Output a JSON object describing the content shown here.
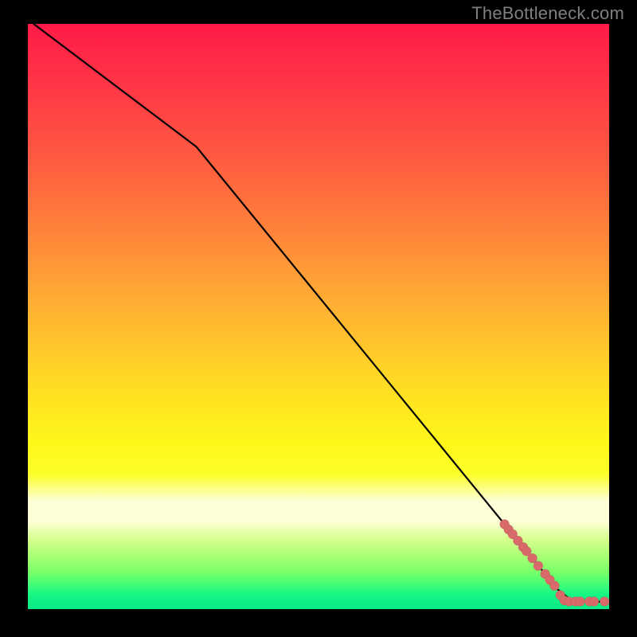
{
  "attribution": "TheBottleneck.com",
  "colors": {
    "point_fill": "#d96a6a",
    "curve_stroke": "#000000",
    "background_black": "#000000",
    "gradient_top": "#ff1a47",
    "gradient_bottom": "#09e986"
  },
  "chart_data": {
    "type": "line",
    "title": "",
    "xlabel": "",
    "ylabel": "",
    "xlim": [
      0,
      100
    ],
    "ylim": [
      0,
      100
    ],
    "note": "Axes are unlabeled in the source image; x/y are on a 0–100 scale estimated from pixel positions inside the plot area.",
    "curve": {
      "name": "bottleneck-curve",
      "points": [
        {
          "x": 1.0,
          "y": 100.0
        },
        {
          "x": 29.0,
          "y": 79.0
        },
        {
          "x": 89.0,
          "y": 6.0
        },
        {
          "x": 91.0,
          "y": 3.5
        },
        {
          "x": 93.5,
          "y": 1.5
        },
        {
          "x": 100.0,
          "y": 1.2
        }
      ]
    },
    "points": {
      "name": "highlighted-data-points",
      "radius": 6,
      "values": [
        {
          "x": 82.0,
          "y": 14.5
        },
        {
          "x": 82.7,
          "y": 13.6
        },
        {
          "x": 83.4,
          "y": 12.8
        },
        {
          "x": 84.3,
          "y": 11.7
        },
        {
          "x": 85.2,
          "y": 10.6
        },
        {
          "x": 85.8,
          "y": 9.9
        },
        {
          "x": 86.8,
          "y": 8.7
        },
        {
          "x": 87.8,
          "y": 7.4
        },
        {
          "x": 89.0,
          "y": 6.0
        },
        {
          "x": 89.8,
          "y": 5.0
        },
        {
          "x": 90.6,
          "y": 4.0
        },
        {
          "x": 91.6,
          "y": 2.4
        },
        {
          "x": 92.3,
          "y": 1.5
        },
        {
          "x": 93.1,
          "y": 1.3
        },
        {
          "x": 94.2,
          "y": 1.3
        },
        {
          "x": 95.0,
          "y": 1.3
        },
        {
          "x": 96.6,
          "y": 1.3
        },
        {
          "x": 97.4,
          "y": 1.3
        },
        {
          "x": 99.2,
          "y": 1.3
        }
      ]
    }
  }
}
